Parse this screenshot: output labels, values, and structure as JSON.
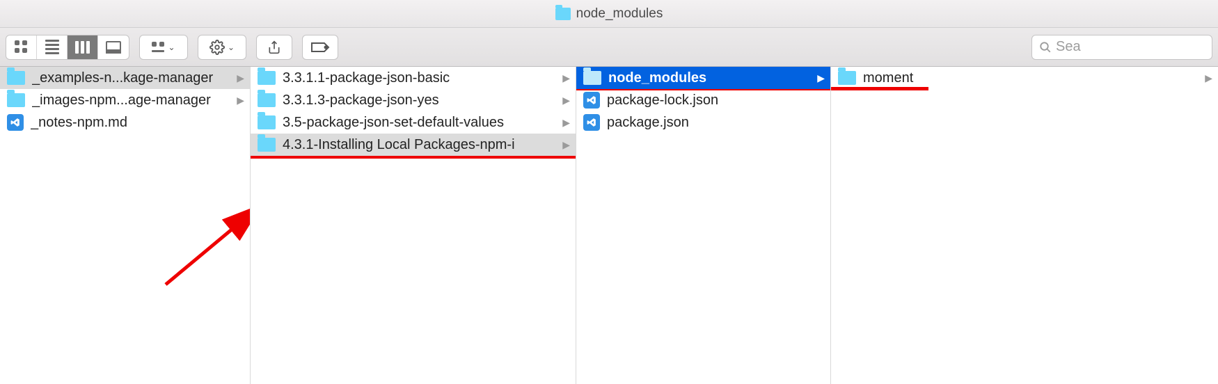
{
  "window": {
    "title": "node_modules"
  },
  "search": {
    "placeholder": "Sea"
  },
  "columns": [
    {
      "items": [
        {
          "type": "folder",
          "label": "_examples-n...kage-manager",
          "selected": "grey",
          "arrow": true
        },
        {
          "type": "folder",
          "label": "_images-npm...age-manager",
          "arrow": true
        },
        {
          "type": "vscode",
          "label": "_notes-npm.md"
        }
      ]
    },
    {
      "items": [
        {
          "type": "folder",
          "label": "3.3.1.1-package-json-basic",
          "arrow": true
        },
        {
          "type": "folder",
          "label": "3.3.1.3-package-json-yes",
          "arrow": true
        },
        {
          "type": "folder",
          "label": "3.5-package-json-set-default-values",
          "arrow": true
        },
        {
          "type": "folder",
          "label": "4.3.1-Installing Local Packages-npm-i",
          "selected": "grey",
          "arrow": true,
          "underline": true
        }
      ]
    },
    {
      "items": [
        {
          "type": "folder",
          "label": "node_modules",
          "selected": "blue",
          "arrow": true,
          "underline": true
        },
        {
          "type": "vscode",
          "label": "package-lock.json"
        },
        {
          "type": "vscode",
          "label": "package.json"
        }
      ]
    },
    {
      "items": [
        {
          "type": "folder",
          "label": "moment",
          "arrow": true,
          "underline": true
        }
      ]
    }
  ]
}
